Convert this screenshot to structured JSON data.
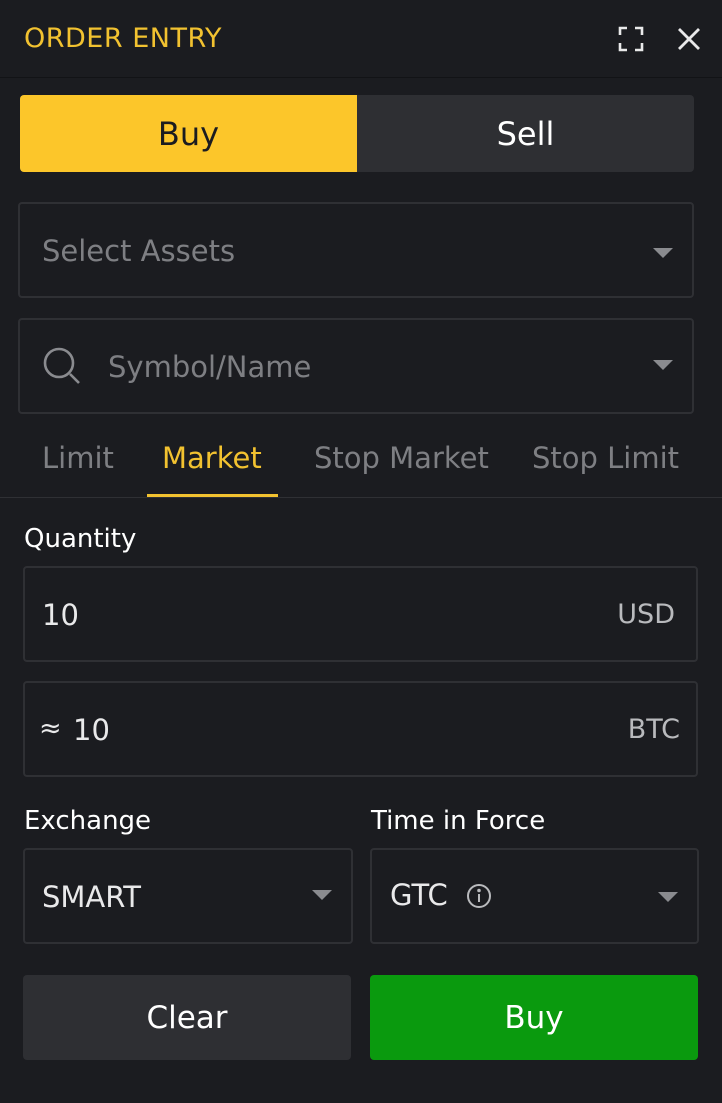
{
  "header": {
    "title": "ORDER ENTRY",
    "expand_icon": "expand-icon",
    "close_icon": "close-icon"
  },
  "side_toggle": {
    "buy_label": "Buy",
    "sell_label": "Sell",
    "selected": "Buy"
  },
  "assets_select": {
    "placeholder": "Select Assets"
  },
  "symbol_search": {
    "placeholder": "Symbol/Name",
    "icon": "search-icon"
  },
  "order_types": {
    "tabs": [
      "Limit",
      "Market",
      "Stop Market",
      "Stop Limit"
    ],
    "selected": "Market"
  },
  "quantity": {
    "label": "Quantity",
    "usd": {
      "value": "10",
      "unit": "USD"
    },
    "btc": {
      "approx": "≈",
      "value": "10",
      "unit": "BTC"
    }
  },
  "exchange": {
    "label": "Exchange",
    "value": "SMART"
  },
  "time_in_force": {
    "label": "Time in Force",
    "value": "GTC",
    "info_icon": "info-icon"
  },
  "actions": {
    "clear_label": "Clear",
    "buy_label": "Buy"
  },
  "colors": {
    "accent": "#f2c230",
    "buy_toggle": "#fcc62a",
    "buy_button": "#0a9a0e",
    "background": "#1b1c20"
  }
}
